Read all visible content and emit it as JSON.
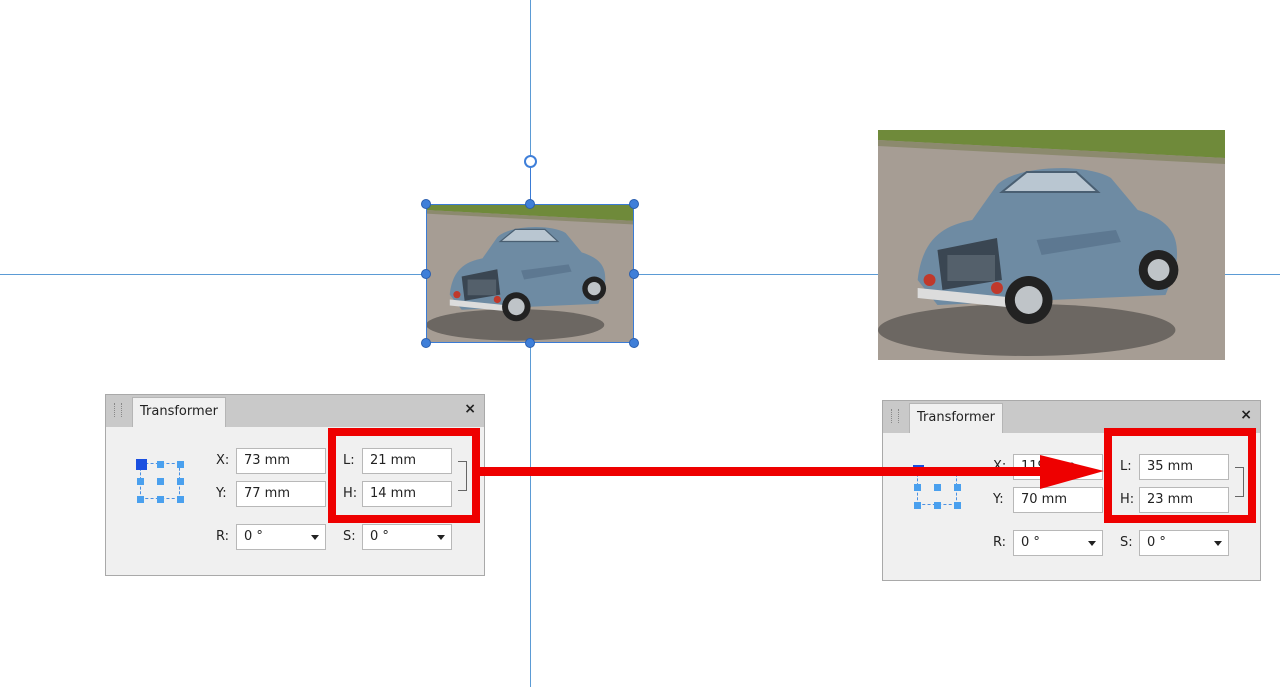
{
  "before": {
    "panel": {
      "title": "Transformer",
      "close": "×",
      "x_label": "X:",
      "x_value": "73 mm",
      "y_label": "Y:",
      "y_value": "77 mm",
      "l_label": "L:",
      "l_value": "21 mm",
      "h_label": "H:",
      "h_value": "14 mm",
      "r_label": "R:",
      "r_value": "0 °",
      "s_label": "S:",
      "s_value": "0 °"
    }
  },
  "after": {
    "panel": {
      "title": "Transformer",
      "close": "×",
      "x_label": "X:",
      "x_value": "119 mm",
      "y_label": "Y:",
      "y_value": "70 mm",
      "l_label": "L:",
      "l_value": "35 mm",
      "h_label": "H:",
      "h_value": "23 mm",
      "r_label": "R:",
      "r_value": "0 °",
      "s_label": "S:",
      "s_value": "0 °"
    }
  },
  "colors": {
    "highlight": "#ee0000",
    "guide": "#5b9bd5",
    "selection": "#3a7bd5"
  }
}
